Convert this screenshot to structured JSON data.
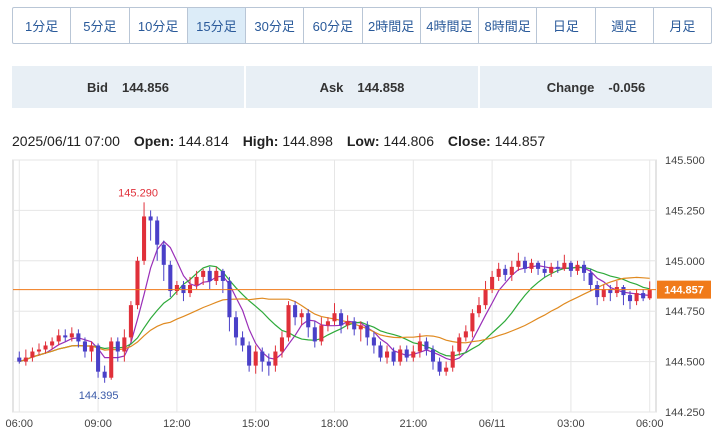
{
  "tabs": [
    "1分足",
    "5分足",
    "10分足",
    "15分足",
    "30分足",
    "60分足",
    "2時間足",
    "4時間足",
    "8時間足",
    "日足",
    "週足",
    "月足"
  ],
  "active_tab": "15分足",
  "quote": {
    "bid_label": "Bid",
    "bid": "144.856",
    "ask_label": "Ask",
    "ask": "144.858",
    "change_label": "Change",
    "change": "-0.056"
  },
  "ohlc": {
    "datetime": "2025/06/11 07:00",
    "open_label": "Open:",
    "open": "144.814",
    "high_label": "High:",
    "high": "144.898",
    "low_label": "Low:",
    "low": "144.806",
    "close_label": "Close:",
    "close": "144.857"
  },
  "colors": {
    "up": "#e0303a",
    "down": "#4a40c8",
    "ma_short": "#9a2fb8",
    "ma_mid": "#2eaa3a",
    "ma_long": "#e08a20",
    "last_price": "#f07a1a",
    "high_label": "#e0303a",
    "low_label": "#3a5aa8"
  },
  "chart_data": {
    "type": "candlestick",
    "ylim": [
      144.25,
      145.5
    ],
    "y_ticks": [
      "145.500",
      "145.250",
      "145.000",
      "144.750",
      "144.500",
      "144.250"
    ],
    "x_tick_labels": [
      "06:00",
      "09:00",
      "12:00",
      "15:00",
      "18:00",
      "21:00",
      "06/11",
      "03:00",
      "06:00"
    ],
    "x_tick_candle_index": [
      0,
      12,
      24,
      36,
      48,
      60,
      72,
      84,
      96
    ],
    "last_price": 144.857,
    "last_price_label": "144.857",
    "high_marker": {
      "label": "145.290",
      "value": 145.29,
      "index": 19
    },
    "low_marker": {
      "label": "144.395",
      "value": 144.395,
      "index": 13
    },
    "candles": [
      [
        144.52,
        144.5,
        144.55,
        144.49
      ],
      [
        144.5,
        144.52,
        144.56,
        144.48
      ],
      [
        144.52,
        144.55,
        144.57,
        144.5
      ],
      [
        144.55,
        144.56,
        144.59,
        144.53
      ],
      [
        144.56,
        144.58,
        144.6,
        144.54
      ],
      [
        144.58,
        144.6,
        144.62,
        144.56
      ],
      [
        144.6,
        144.63,
        144.66,
        144.58
      ],
      [
        144.63,
        144.62,
        144.66,
        144.6
      ],
      [
        144.62,
        144.64,
        144.67,
        144.6
      ],
      [
        144.64,
        144.6,
        144.66,
        144.57
      ],
      [
        144.6,
        144.55,
        144.62,
        144.52
      ],
      [
        144.55,
        144.58,
        144.6,
        144.5
      ],
      [
        144.58,
        144.45,
        144.59,
        144.42
      ],
      [
        144.45,
        144.42,
        144.48,
        144.395
      ],
      [
        144.42,
        144.6,
        144.62,
        144.41
      ],
      [
        144.6,
        144.55,
        144.62,
        144.5
      ],
      [
        144.55,
        144.62,
        144.66,
        144.5
      ],
      [
        144.62,
        144.78,
        144.8,
        144.6
      ],
      [
        144.78,
        145.0,
        145.02,
        144.76
      ],
      [
        145.0,
        145.22,
        145.29,
        144.98
      ],
      [
        145.22,
        145.2,
        145.25,
        145.1
      ],
      [
        145.2,
        145.08,
        145.22,
        145.0
      ],
      [
        145.08,
        144.98,
        145.1,
        144.9
      ],
      [
        144.98,
        144.85,
        145.0,
        144.82
      ],
      [
        144.85,
        144.88,
        144.9,
        144.83
      ],
      [
        144.88,
        144.84,
        144.9,
        144.8
      ],
      [
        144.84,
        144.88,
        144.92,
        144.82
      ],
      [
        144.88,
        144.92,
        144.95,
        144.86
      ],
      [
        144.92,
        144.95,
        144.96,
        144.88
      ],
      [
        144.95,
        144.9,
        144.97,
        144.86
      ],
      [
        144.9,
        144.95,
        144.97,
        144.88
      ],
      [
        144.95,
        144.9,
        144.96,
        144.84
      ],
      [
        144.9,
        144.72,
        144.92,
        144.65
      ],
      [
        144.72,
        144.62,
        144.75,
        144.58
      ],
      [
        144.62,
        144.58,
        144.65,
        144.55
      ],
      [
        144.58,
        144.48,
        144.6,
        144.45
      ],
      [
        144.48,
        144.55,
        144.58,
        144.44
      ],
      [
        144.55,
        144.5,
        144.57,
        144.45
      ],
      [
        144.5,
        144.48,
        144.54,
        144.43
      ],
      [
        144.48,
        144.55,
        144.58,
        144.45
      ],
      [
        144.55,
        144.62,
        144.65,
        144.52
      ],
      [
        144.62,
        144.78,
        144.8,
        144.6
      ],
      [
        144.78,
        144.72,
        144.8,
        144.68
      ],
      [
        144.72,
        144.74,
        144.76,
        144.68
      ],
      [
        144.74,
        144.67,
        144.76,
        144.62
      ],
      [
        144.67,
        144.6,
        144.7,
        144.57
      ],
      [
        144.6,
        144.68,
        144.72,
        144.58
      ],
      [
        144.68,
        144.7,
        144.72,
        144.65
      ],
      [
        144.7,
        144.74,
        144.79,
        144.68
      ],
      [
        144.74,
        144.68,
        144.76,
        144.64
      ],
      [
        144.68,
        144.7,
        144.73,
        144.66
      ],
      [
        144.7,
        144.66,
        144.72,
        144.63
      ],
      [
        144.66,
        144.68,
        144.7,
        144.6
      ],
      [
        144.68,
        144.62,
        144.7,
        144.58
      ],
      [
        144.62,
        144.58,
        144.65,
        144.54
      ],
      [
        144.58,
        144.52,
        144.6,
        144.5
      ],
      [
        144.52,
        144.55,
        144.58,
        144.49
      ],
      [
        144.55,
        144.5,
        144.57,
        144.48
      ],
      [
        144.5,
        144.56,
        144.58,
        144.48
      ],
      [
        144.56,
        144.52,
        144.58,
        144.5
      ],
      [
        144.52,
        144.55,
        144.58,
        144.5
      ],
      [
        144.55,
        144.6,
        144.64,
        144.52
      ],
      [
        144.6,
        144.56,
        144.62,
        144.53
      ],
      [
        144.56,
        144.5,
        144.58,
        144.46
      ],
      [
        144.5,
        144.45,
        144.52,
        144.43
      ],
      [
        144.45,
        144.47,
        144.5,
        144.43
      ],
      [
        144.47,
        144.55,
        144.58,
        144.45
      ],
      [
        144.55,
        144.62,
        144.64,
        144.53
      ],
      [
        144.62,
        144.65,
        144.68,
        144.6
      ],
      [
        144.65,
        144.74,
        144.76,
        144.62
      ],
      [
        144.74,
        144.78,
        144.82,
        144.72
      ],
      [
        144.78,
        144.86,
        144.9,
        144.76
      ],
      [
        144.86,
        144.92,
        144.95,
        144.84
      ],
      [
        144.92,
        144.96,
        144.99,
        144.9
      ],
      [
        144.96,
        144.93,
        144.98,
        144.9
      ],
      [
        144.93,
        144.97,
        145.0,
        144.9
      ],
      [
        144.97,
        145.0,
        145.04,
        144.95
      ],
      [
        145.0,
        144.96,
        145.02,
        144.94
      ],
      [
        144.96,
        144.99,
        145.01,
        144.94
      ],
      [
        144.99,
        144.96,
        145.0,
        144.93
      ],
      [
        144.96,
        144.94,
        145.0,
        144.92
      ],
      [
        144.94,
        144.97,
        144.99,
        144.92
      ],
      [
        144.97,
        144.96,
        145.0,
        144.94
      ],
      [
        144.96,
        144.99,
        145.03,
        144.95
      ],
      [
        144.99,
        144.95,
        145.0,
        144.92
      ],
      [
        144.95,
        144.98,
        145.0,
        144.93
      ],
      [
        144.98,
        144.94,
        145.0,
        144.9
      ],
      [
        144.94,
        144.88,
        144.96,
        144.85
      ],
      [
        144.88,
        144.82,
        144.9,
        144.78
      ],
      [
        144.82,
        144.86,
        144.88,
        144.8
      ],
      [
        144.86,
        144.84,
        144.88,
        144.8
      ],
      [
        144.84,
        144.87,
        144.9,
        144.82
      ],
      [
        144.87,
        144.83,
        144.88,
        144.78
      ],
      [
        144.83,
        144.8,
        144.85,
        144.76
      ],
      [
        144.8,
        144.84,
        144.86,
        144.78
      ],
      [
        144.84,
        144.814,
        144.86,
        144.8
      ],
      [
        144.814,
        144.857,
        144.898,
        144.806
      ]
    ]
  }
}
